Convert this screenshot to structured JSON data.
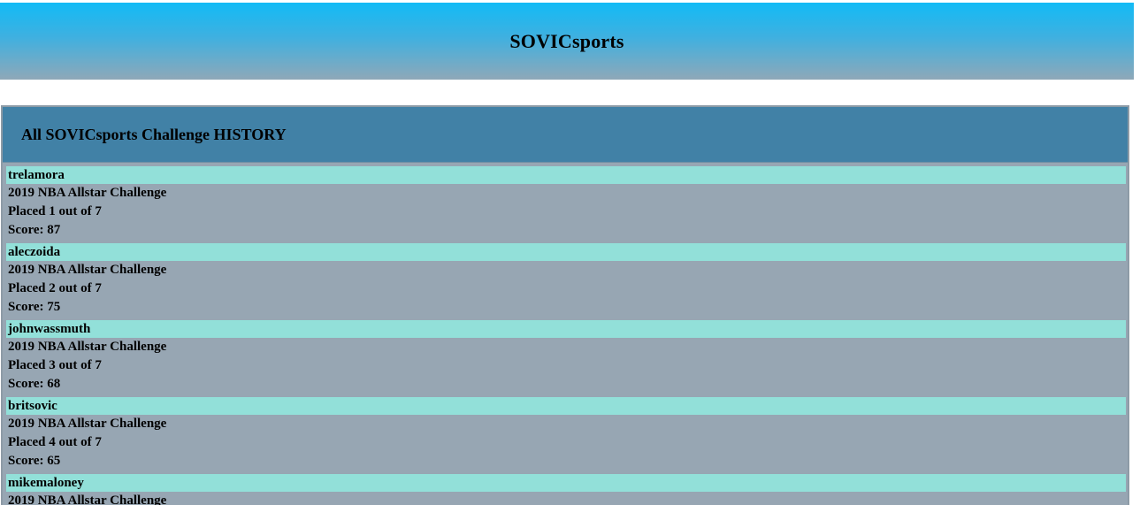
{
  "header": {
    "title": "SOVICsports"
  },
  "history": {
    "title": "All SOVICsports Challenge HISTORY",
    "entries": [
      {
        "user": "trelamora",
        "challenge": "2019 NBA Allstar Challenge",
        "placed": "Placed 1 out of 7",
        "score": "Score: 87"
      },
      {
        "user": "aleczoida",
        "challenge": "2019 NBA Allstar Challenge",
        "placed": "Placed 2 out of 7",
        "score": "Score: 75"
      },
      {
        "user": "johnwassmuth",
        "challenge": "2019 NBA Allstar Challenge",
        "placed": "Placed 3 out of 7",
        "score": "Score: 68"
      },
      {
        "user": "britsovic",
        "challenge": "2019 NBA Allstar Challenge",
        "placed": "Placed 4 out of 7",
        "score": "Score: 65"
      },
      {
        "user": "mikemaloney",
        "challenge": "2019 NBA Allstar Challenge",
        "placed": "",
        "score": ""
      }
    ]
  }
}
